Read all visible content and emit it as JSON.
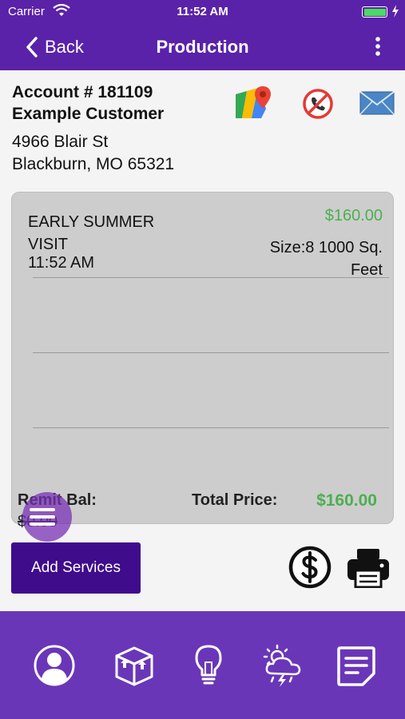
{
  "status_bar": {
    "carrier": "Carrier",
    "time": "11:52 AM",
    "battery_color": "#4cd964"
  },
  "nav": {
    "back_label": "Back",
    "title": "Production",
    "more_icon": "more-vertical-icon"
  },
  "customer": {
    "account_line": "Account # 181109",
    "name": "Example Customer",
    "address_line1": "4966 Blair St",
    "address_line2": "Blackburn, MO 65321"
  },
  "actions": {
    "map_icon": "map-pin-icon",
    "no_call_icon": "no-call-icon",
    "email_icon": "email-icon"
  },
  "visit": {
    "name": "EARLY SUMMER VISIT",
    "time": "11:52 AM",
    "price": "$160.00",
    "size": "Size:8 1000 Sq. Feet",
    "remit_label": "Remit Bal:",
    "remit_value": "$0.00",
    "total_label": "Total Price:",
    "total_value": "$160.00"
  },
  "buttons": {
    "add_services": "Add Services",
    "payment_icon": "dollar-circle-icon",
    "print_icon": "printer-icon",
    "menu_icon": "menu-icon"
  },
  "tabs": [
    {
      "icon": "account-icon"
    },
    {
      "icon": "package-icon"
    },
    {
      "icon": "lightbulb-icon"
    },
    {
      "icon": "weather-icon"
    },
    {
      "icon": "notes-icon"
    }
  ],
  "colors": {
    "primary": "#5a22a8",
    "tab_bar": "#6a36b8",
    "button": "#3f0c8c",
    "price_green": "#4caf50",
    "card": "#cdcdcd"
  }
}
